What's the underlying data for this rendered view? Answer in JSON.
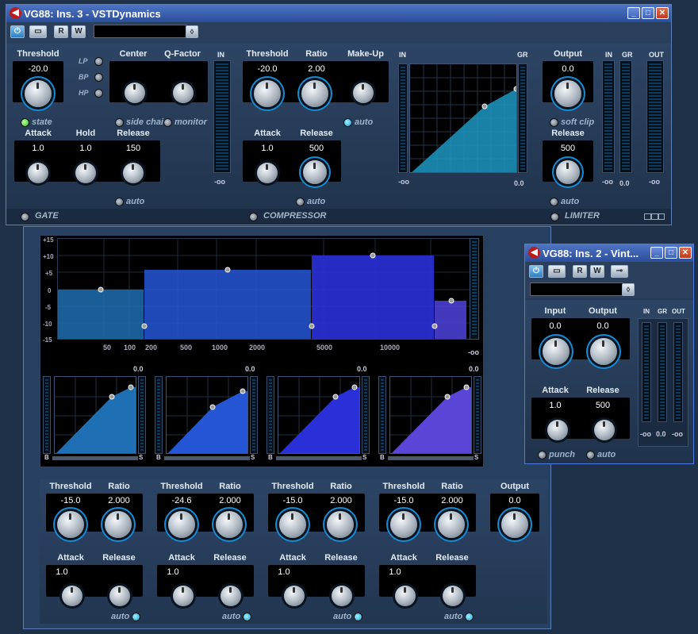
{
  "win1": {
    "title": "VG88: Ins. 3 - VSTDynamics",
    "toolbar": {
      "r": "R",
      "w": "W"
    },
    "gate": {
      "threshold_label": "Threshold",
      "threshold": "-20.0",
      "state": "state",
      "filters": [
        "LP",
        "BP",
        "HP"
      ],
      "center_label": "Center",
      "qfactor_label": "Q-Factor",
      "side_chain": "side chain",
      "monitor": "monitor",
      "attack_label": "Attack",
      "attack": "1.0",
      "hold_label": "Hold",
      "hold": "1.0",
      "release_label": "Release",
      "release": "150",
      "auto": "auto",
      "section": "GATE",
      "in_label": "IN",
      "in_value": "-oo"
    },
    "comp": {
      "threshold_label": "Threshold",
      "threshold": "-20.0",
      "ratio_label": "Ratio",
      "ratio": "2.00",
      "makeup_label": "Make-Up",
      "auto1": "auto",
      "attack_label": "Attack",
      "attack": "1.0",
      "release_label": "Release",
      "release": "500",
      "auto2": "auto",
      "section": "COMPRESSOR",
      "in_label": "IN",
      "gr_label": "GR",
      "in_value": "-oo",
      "out_value": "0.0"
    },
    "limiter": {
      "output_label": "Output",
      "output": "0.0",
      "soft_clip": "soft clip",
      "release_label": "Release",
      "release": "500",
      "auto": "auto",
      "section": "LIMITER",
      "in_label": "IN",
      "gr_label": "GR",
      "out_label": "OUT",
      "in_value": "-oo",
      "gr_value": "0.0",
      "out_value": "-oo"
    }
  },
  "win2": {
    "db_ticks": [
      "+15",
      "+10",
      "+5",
      "0",
      "-5",
      "-10",
      "-15"
    ],
    "freq_ticks": [
      "50",
      "100",
      "200",
      "500",
      "1000",
      "2000",
      "5000",
      "10000"
    ],
    "meter_value": "-oo",
    "band_peaks": [
      "0.0",
      "0.0",
      "0.0",
      "0.0"
    ],
    "band_axis": [
      "B",
      "S"
    ],
    "bands": [
      {
        "threshold_label": "Threshold",
        "threshold": "-15.0",
        "ratio_label": "Ratio",
        "ratio": "2.000",
        "attack_label": "Attack",
        "attack": "1.0",
        "release_label": "Release",
        "auto": "auto"
      },
      {
        "threshold_label": "Threshold",
        "threshold": "-24.6",
        "ratio_label": "Ratio",
        "ratio": "2.000",
        "attack_label": "Attack",
        "attack": "1.0",
        "release_label": "Release",
        "auto": "auto"
      },
      {
        "threshold_label": "Threshold",
        "threshold": "-15.0",
        "ratio_label": "Ratio",
        "ratio": "2.000",
        "attack_label": "Attack",
        "attack": "1.0",
        "release_label": "Release",
        "auto": "auto"
      },
      {
        "threshold_label": "Threshold",
        "threshold": "-15.0",
        "ratio_label": "Ratio",
        "ratio": "2.000",
        "attack_label": "Attack",
        "attack": "1.0",
        "release_label": "Release",
        "auto": "auto"
      }
    ],
    "output_label": "Output",
    "output": "0.0"
  },
  "win3": {
    "title": "VG88: Ins. 2 - Vint...",
    "toolbar": {
      "r": "R",
      "w": "W"
    },
    "input_label": "Input",
    "input": "0.0",
    "output_label": "Output",
    "output": "0.0",
    "attack_label": "Attack",
    "attack": "1.0",
    "release_label": "Release",
    "release": "500",
    "punch": "punch",
    "auto": "auto",
    "meters": {
      "in": "IN",
      "gr": "GR",
      "out": "OUT",
      "v1": "-oo",
      "v2": "0.0",
      "v3": "-oo"
    }
  }
}
